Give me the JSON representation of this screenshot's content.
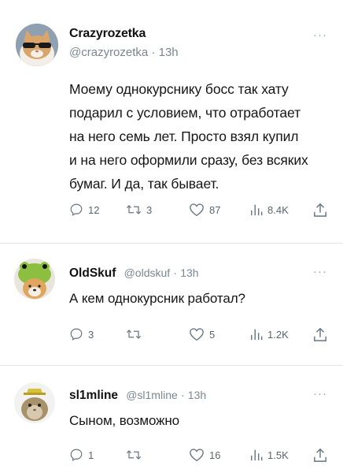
{
  "tweets": [
    {
      "name": "Crazyrozetka",
      "handle": "@crazyrozetka",
      "separator": "·",
      "time": "13h",
      "more": "···",
      "text_lines": [
        "Моему однокурснику босс так хату",
        "подарил с условием, что отработает",
        "на него семь лет. Просто взял купил",
        "и на него оформили сразу, без всяких",
        "бумаг. И да, так бывает."
      ],
      "replies": "12",
      "retweets": "3",
      "likes": "87",
      "views": "8.4K",
      "avatar": "cat-with-sunglasses"
    },
    {
      "name": "OldSkuf",
      "handle": "@oldskuf",
      "separator": "·",
      "time": "13h",
      "more": "···",
      "text_lines": [
        "А кем однокурсник работал?"
      ],
      "replies": "3",
      "retweets": "",
      "likes": "5",
      "views": "1.2K",
      "avatar": "dog-in-frog-hat"
    },
    {
      "name": "sl1mline",
      "handle": "@sl1mline",
      "separator": "·",
      "time": "13h",
      "more": "···",
      "text_lines": [
        "Сыном, возможно"
      ],
      "replies": "1",
      "retweets": "",
      "likes": "16",
      "views": "1.5K",
      "avatar": "hamster-with-hat"
    }
  ],
  "icons": {
    "reply": "reply-icon",
    "retweet": "retweet-icon",
    "like": "heart-icon",
    "views": "views-icon",
    "share": "share-icon"
  }
}
